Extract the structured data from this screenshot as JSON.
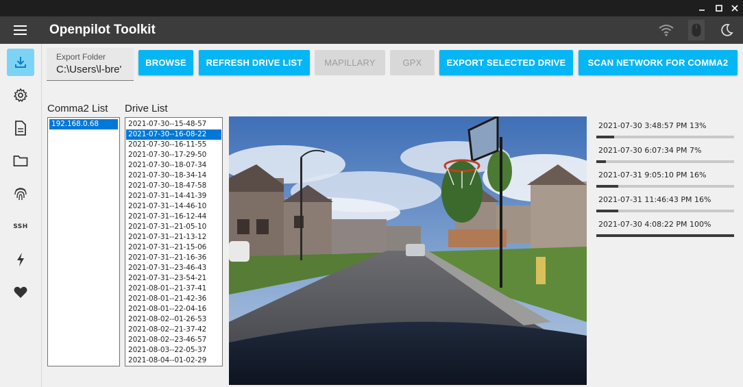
{
  "window": {
    "minimize": "–",
    "maximize": "□",
    "close": "✕"
  },
  "app": {
    "title": "Openpilot Toolkit"
  },
  "topbar_icons": [
    "wifi-icon",
    "mouse-icon",
    "moon-icon"
  ],
  "sidebar": {
    "items": [
      {
        "name": "download-icon",
        "active": true
      },
      {
        "name": "gear-icon",
        "active": false
      },
      {
        "name": "document-icon",
        "active": false
      },
      {
        "name": "folder-icon",
        "active": false
      },
      {
        "name": "fingerprint-icon",
        "active": false
      },
      {
        "name": "ssh-icon",
        "label": "SSH",
        "active": false
      },
      {
        "name": "lightning-icon",
        "active": false
      },
      {
        "name": "heart-icon",
        "active": false
      }
    ]
  },
  "toolbar": {
    "export_folder_label": "Export Folder",
    "export_folder_value": "C:\\Users\\l-bre'",
    "browse": "BROWSE",
    "refresh": "REFRESH DRIVE LIST",
    "mapillary": "MAPILLARY",
    "gpx": "GPX",
    "export_selected": "EXPORT SELECTED DRIVE",
    "scan": "SCAN NETWORK FOR COMMA2"
  },
  "comma2_list": {
    "label": "Comma2 List",
    "items": [
      "192.168.0.68"
    ],
    "selected_index": 0
  },
  "drive_list": {
    "label": "Drive List",
    "selected_index": 1,
    "items": [
      "2021-07-30--15-48-57",
      "2021-07-30--16-08-22",
      "2021-07-30--16-11-55",
      "2021-07-30--17-29-50",
      "2021-07-30--18-07-34",
      "2021-07-30--18-34-14",
      "2021-07-30--18-47-58",
      "2021-07-31--14-41-39",
      "2021-07-31--14-46-10",
      "2021-07-31--16-12-44",
      "2021-07-31--21-05-10",
      "2021-07-31--21-13-12",
      "2021-07-31--21-15-06",
      "2021-07-31--21-16-36",
      "2021-07-31--23-46-43",
      "2021-07-31--23-54-21",
      "2021-08-01--21-37-41",
      "2021-08-01--21-42-36",
      "2021-08-01--22-04-16",
      "2021-08-02--01-26-53",
      "2021-08-02--21-37-42",
      "2021-08-02--23-46-57",
      "2021-08-03--22-05-37",
      "2021-08-04--01-02-29"
    ]
  },
  "exports": [
    {
      "label": "2021-07-30 3:48:57 PM 13%",
      "progress": 13
    },
    {
      "label": "2021-07-30 6:07:34 PM 7%",
      "progress": 7
    },
    {
      "label": "2021-07-31 9:05:10 PM 16%",
      "progress": 16
    },
    {
      "label": "2021-07-31 11:46:43 PM 16%",
      "progress": 16
    },
    {
      "label": "2021-07-30 4:08:22 PM 100%",
      "progress": 100
    }
  ],
  "colors": {
    "accent": "#05b6f5",
    "appbar": "#3c3c3c",
    "selection": "#0078d7",
    "sidebar_active": "#7dd3f5"
  }
}
